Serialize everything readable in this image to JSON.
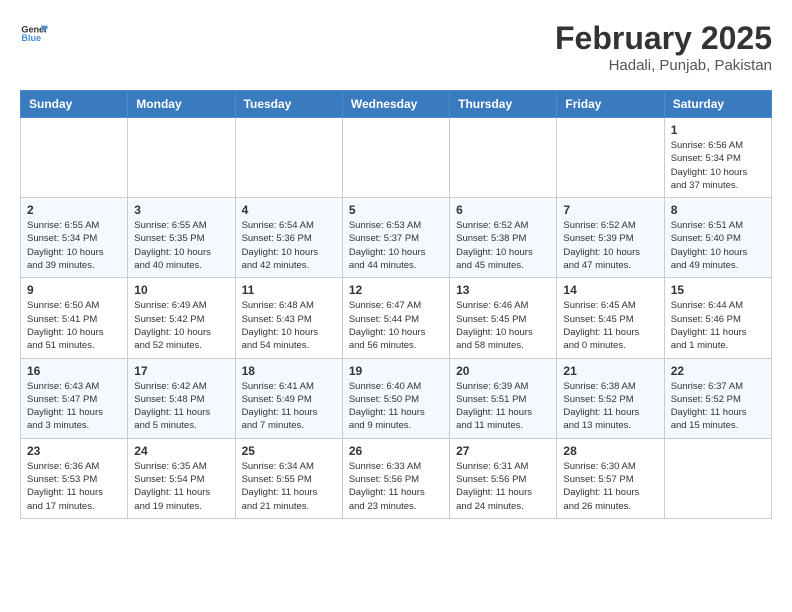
{
  "header": {
    "logo_general": "General",
    "logo_blue": "Blue",
    "month": "February 2025",
    "location": "Hadali, Punjab, Pakistan"
  },
  "weekdays": [
    "Sunday",
    "Monday",
    "Tuesday",
    "Wednesday",
    "Thursday",
    "Friday",
    "Saturday"
  ],
  "weeks": [
    [
      {
        "day": "",
        "info": ""
      },
      {
        "day": "",
        "info": ""
      },
      {
        "day": "",
        "info": ""
      },
      {
        "day": "",
        "info": ""
      },
      {
        "day": "",
        "info": ""
      },
      {
        "day": "",
        "info": ""
      },
      {
        "day": "1",
        "info": "Sunrise: 6:56 AM\nSunset: 5:34 PM\nDaylight: 10 hours and 37 minutes."
      }
    ],
    [
      {
        "day": "2",
        "info": "Sunrise: 6:55 AM\nSunset: 5:34 PM\nDaylight: 10 hours and 39 minutes."
      },
      {
        "day": "3",
        "info": "Sunrise: 6:55 AM\nSunset: 5:35 PM\nDaylight: 10 hours and 40 minutes."
      },
      {
        "day": "4",
        "info": "Sunrise: 6:54 AM\nSunset: 5:36 PM\nDaylight: 10 hours and 42 minutes."
      },
      {
        "day": "5",
        "info": "Sunrise: 6:53 AM\nSunset: 5:37 PM\nDaylight: 10 hours and 44 minutes."
      },
      {
        "day": "6",
        "info": "Sunrise: 6:52 AM\nSunset: 5:38 PM\nDaylight: 10 hours and 45 minutes."
      },
      {
        "day": "7",
        "info": "Sunrise: 6:52 AM\nSunset: 5:39 PM\nDaylight: 10 hours and 47 minutes."
      },
      {
        "day": "8",
        "info": "Sunrise: 6:51 AM\nSunset: 5:40 PM\nDaylight: 10 hours and 49 minutes."
      }
    ],
    [
      {
        "day": "9",
        "info": "Sunrise: 6:50 AM\nSunset: 5:41 PM\nDaylight: 10 hours and 51 minutes."
      },
      {
        "day": "10",
        "info": "Sunrise: 6:49 AM\nSunset: 5:42 PM\nDaylight: 10 hours and 52 minutes."
      },
      {
        "day": "11",
        "info": "Sunrise: 6:48 AM\nSunset: 5:43 PM\nDaylight: 10 hours and 54 minutes."
      },
      {
        "day": "12",
        "info": "Sunrise: 6:47 AM\nSunset: 5:44 PM\nDaylight: 10 hours and 56 minutes."
      },
      {
        "day": "13",
        "info": "Sunrise: 6:46 AM\nSunset: 5:45 PM\nDaylight: 10 hours and 58 minutes."
      },
      {
        "day": "14",
        "info": "Sunrise: 6:45 AM\nSunset: 5:45 PM\nDaylight: 11 hours and 0 minutes."
      },
      {
        "day": "15",
        "info": "Sunrise: 6:44 AM\nSunset: 5:46 PM\nDaylight: 11 hours and 1 minute."
      }
    ],
    [
      {
        "day": "16",
        "info": "Sunrise: 6:43 AM\nSunset: 5:47 PM\nDaylight: 11 hours and 3 minutes."
      },
      {
        "day": "17",
        "info": "Sunrise: 6:42 AM\nSunset: 5:48 PM\nDaylight: 11 hours and 5 minutes."
      },
      {
        "day": "18",
        "info": "Sunrise: 6:41 AM\nSunset: 5:49 PM\nDaylight: 11 hours and 7 minutes."
      },
      {
        "day": "19",
        "info": "Sunrise: 6:40 AM\nSunset: 5:50 PM\nDaylight: 11 hours and 9 minutes."
      },
      {
        "day": "20",
        "info": "Sunrise: 6:39 AM\nSunset: 5:51 PM\nDaylight: 11 hours and 11 minutes."
      },
      {
        "day": "21",
        "info": "Sunrise: 6:38 AM\nSunset: 5:52 PM\nDaylight: 11 hours and 13 minutes."
      },
      {
        "day": "22",
        "info": "Sunrise: 6:37 AM\nSunset: 5:52 PM\nDaylight: 11 hours and 15 minutes."
      }
    ],
    [
      {
        "day": "23",
        "info": "Sunrise: 6:36 AM\nSunset: 5:53 PM\nDaylight: 11 hours and 17 minutes."
      },
      {
        "day": "24",
        "info": "Sunrise: 6:35 AM\nSunset: 5:54 PM\nDaylight: 11 hours and 19 minutes."
      },
      {
        "day": "25",
        "info": "Sunrise: 6:34 AM\nSunset: 5:55 PM\nDaylight: 11 hours and 21 minutes."
      },
      {
        "day": "26",
        "info": "Sunrise: 6:33 AM\nSunset: 5:56 PM\nDaylight: 11 hours and 23 minutes."
      },
      {
        "day": "27",
        "info": "Sunrise: 6:31 AM\nSunset: 5:56 PM\nDaylight: 11 hours and 24 minutes."
      },
      {
        "day": "28",
        "info": "Sunrise: 6:30 AM\nSunset: 5:57 PM\nDaylight: 11 hours and 26 minutes."
      },
      {
        "day": "",
        "info": ""
      }
    ]
  ]
}
